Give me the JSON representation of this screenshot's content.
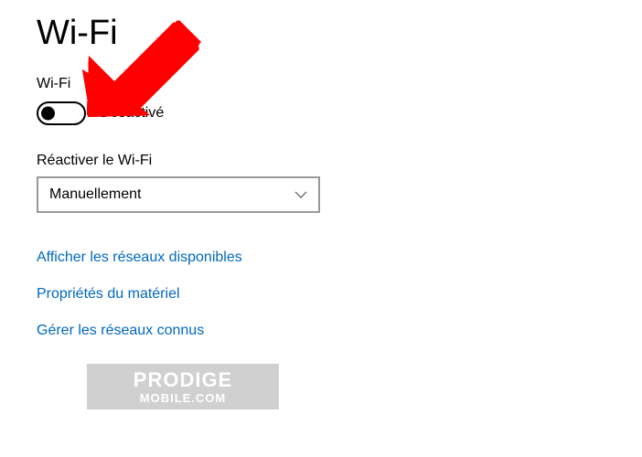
{
  "page": {
    "title": "Wi-Fi"
  },
  "wifi": {
    "label": "Wi-Fi",
    "toggle_state": "Désactivé"
  },
  "reactivate": {
    "label": "Réactiver le Wi-Fi",
    "selected": "Manuellement"
  },
  "links": {
    "available_networks": "Afficher les réseaux disponibles",
    "hardware_properties": "Propriétés du matériel",
    "known_networks": "Gérer les réseaux connus"
  },
  "watermark": {
    "line1": "PRODIGE",
    "line2": "MOBILE.COM"
  }
}
